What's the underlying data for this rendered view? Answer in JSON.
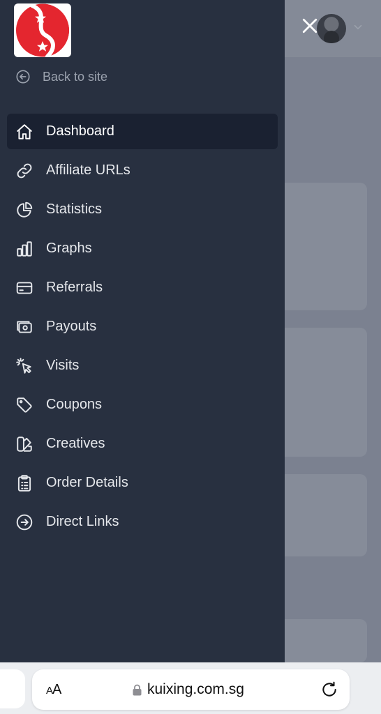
{
  "logo": {
    "icon": "yin-yang-stars-logo",
    "colors": {
      "red": "#e4262f",
      "white": "#ffffff"
    }
  },
  "back_link": {
    "label": "Back to site",
    "icon": "arrow-left-circle-icon"
  },
  "nav": {
    "items": [
      {
        "label": "Dashboard",
        "icon": "home-icon",
        "active": true
      },
      {
        "label": "Affiliate URLs",
        "icon": "link-icon"
      },
      {
        "label": "Statistics",
        "icon": "pie-chart-icon"
      },
      {
        "label": "Graphs",
        "icon": "bar-chart-icon"
      },
      {
        "label": "Referrals",
        "icon": "credit-card-icon"
      },
      {
        "label": "Payouts",
        "icon": "cash-icon"
      },
      {
        "label": "Visits",
        "icon": "cursor-click-icon"
      },
      {
        "label": "Coupons",
        "icon": "tag-icon"
      },
      {
        "label": "Creatives",
        "icon": "color-swatch-icon"
      },
      {
        "label": "Order Details",
        "icon": "clipboard-list-icon"
      },
      {
        "label": "Direct Links",
        "icon": "arrow-right-circle-icon"
      }
    ]
  },
  "header": {
    "close_icon": "close-icon",
    "avatar": "user-avatar",
    "menu_icon": "chevron-down-icon"
  },
  "browser": {
    "text_size_label_small": "A",
    "text_size_label_large": "A",
    "url": "kuixing.com.sg"
  },
  "colors": {
    "sidebar_bg": "#283040",
    "active_bg": "#1a2131",
    "overlay": "#7b8190"
  }
}
